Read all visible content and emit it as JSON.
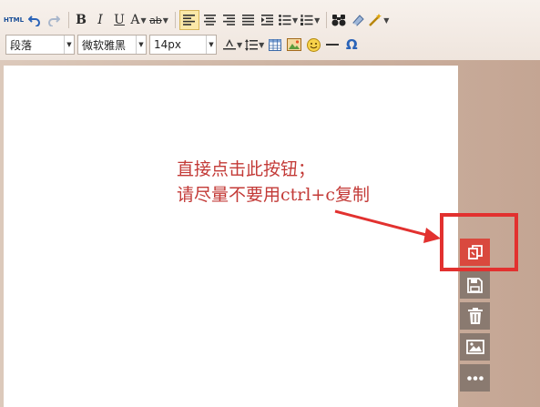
{
  "toolbar": {
    "row1": {
      "html_label": "HTML",
      "bold": "B",
      "italic": "I",
      "underline": "U",
      "font_color": "A",
      "highlight": "ab"
    },
    "row2": {
      "paragraph_format": "段落",
      "font_family": "微软雅黑",
      "font_size": "14px",
      "omega": "Ω"
    }
  },
  "editor": {
    "annotation_line1": "直接点击此按钮；",
    "annotation_line2": "请尽量不要用ctrl+c复制"
  },
  "colors": {
    "accent_red": "#d9493e",
    "annotation_red": "#c33a37",
    "sidebar_gray": "#8a7a70"
  },
  "sidebar": {
    "buttons": [
      "copy-icon",
      "save-icon",
      "trash-icon",
      "image-icon",
      "more-icon"
    ]
  }
}
